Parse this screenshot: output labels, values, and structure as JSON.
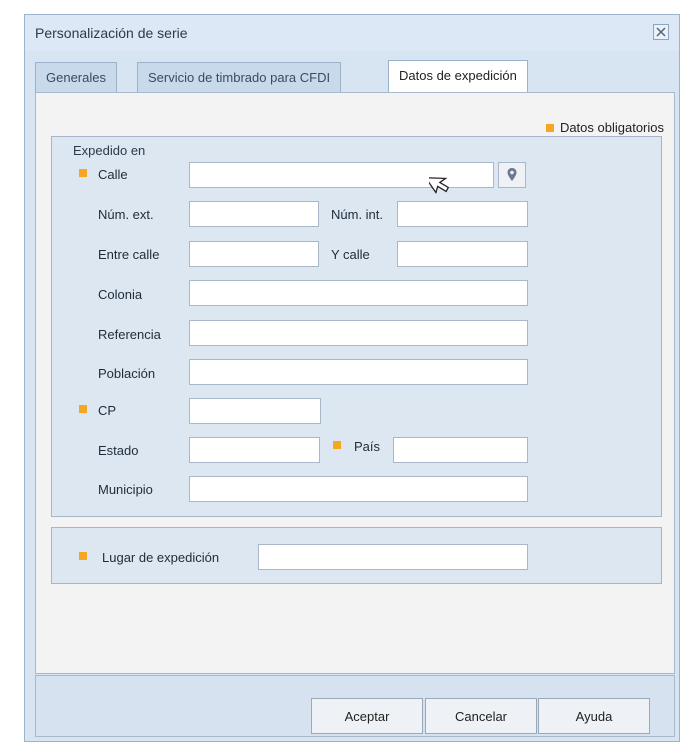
{
  "window": {
    "title": "Personalización de serie"
  },
  "tabs": [
    {
      "label": "Generales",
      "active": false
    },
    {
      "label": "Servicio de timbrado para CFDI",
      "active": false
    },
    {
      "label": "Datos de expedición",
      "active": true
    }
  ],
  "legend": {
    "label": "Datos obligatorios"
  },
  "expedido": {
    "title": "Expedido en",
    "fields": {
      "calle": {
        "label": "Calle",
        "value": "",
        "required": true
      },
      "num_ext": {
        "label": "Núm. ext.",
        "value": ""
      },
      "num_int": {
        "label": "Núm. int.",
        "value": ""
      },
      "entre_calle": {
        "label": "Entre calle",
        "value": ""
      },
      "y_calle": {
        "label": "Y calle",
        "value": ""
      },
      "colonia": {
        "label": "Colonia",
        "value": ""
      },
      "referencia": {
        "label": "Referencia",
        "value": ""
      },
      "poblacion": {
        "label": "Población",
        "value": ""
      },
      "cp": {
        "label": "CP",
        "value": "",
        "required": true
      },
      "estado": {
        "label": "Estado",
        "value": ""
      },
      "pais": {
        "label": "País",
        "value": "",
        "required": true
      },
      "municipio": {
        "label": "Municipio",
        "value": ""
      }
    }
  },
  "lugar": {
    "label": "Lugar de expedición",
    "value": "",
    "required": true
  },
  "buttons": {
    "aceptar": "Aceptar",
    "cancelar": "Cancelar",
    "ayuda": "Ayuda"
  },
  "icons": {
    "close": "close-icon",
    "pin": "map-pin-icon",
    "cursor": "mouse-cursor-icon"
  },
  "colors": {
    "required": "#f6a623",
    "window_bg": "#d7e4f2"
  }
}
